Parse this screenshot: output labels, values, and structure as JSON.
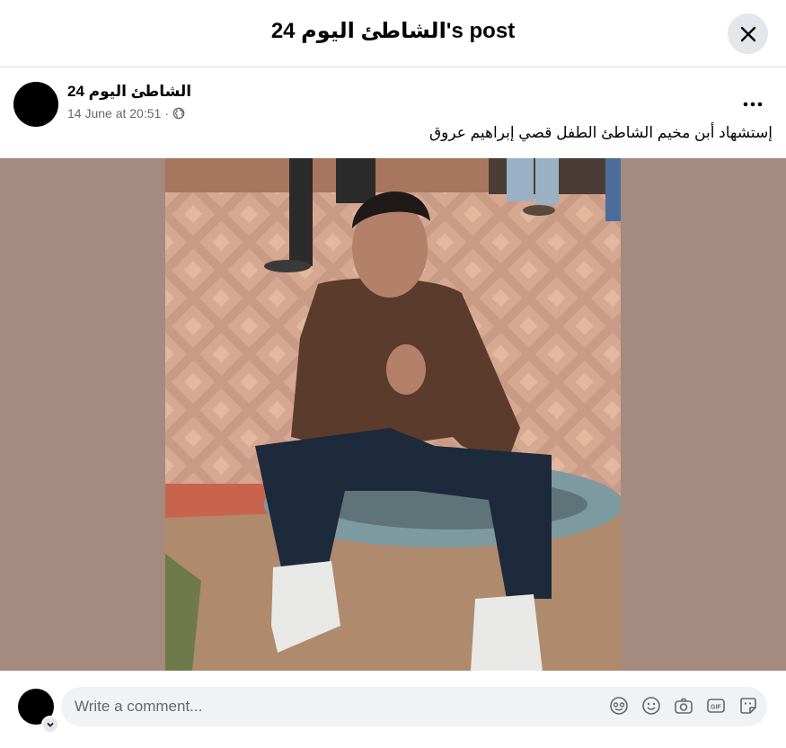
{
  "dialog": {
    "title": "الشاطئ اليوم 24's post"
  },
  "post": {
    "author": "الشاطئ اليوم 24",
    "timestamp": "14 June at 20:51",
    "separator": "·",
    "audience_icon": "globe-icon",
    "text": "إستشهاد أبن مخيم الشاطئ الطفل قصي إبراهيم عروق"
  },
  "comment_box": {
    "placeholder": "Write a comment...",
    "icons": [
      "avatar-sticker-icon",
      "emoji-icon",
      "camera-icon",
      "gif-icon",
      "sticker-icon"
    ]
  },
  "colors": {
    "photo_background": "#a48a7f",
    "secondary_text": "#65676b"
  }
}
